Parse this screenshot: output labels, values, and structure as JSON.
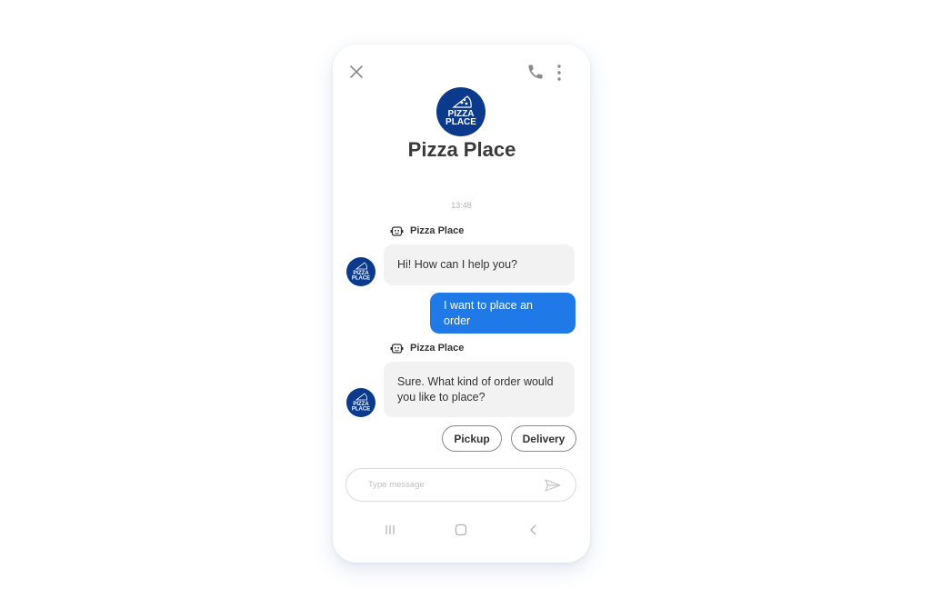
{
  "header": {
    "close_icon": "close-icon",
    "call_icon": "phone-icon",
    "menu_icon": "more-vertical-icon",
    "logo_text_line1": "PIZZA",
    "logo_text_line2": "PLACE",
    "title": "Pizza Place"
  },
  "chat": {
    "timestamp": "13:48",
    "messages": [
      {
        "from": "bot",
        "sender": "Pizza Place",
        "lines": [
          "Hi! How can I help you?"
        ]
      },
      {
        "from": "user",
        "lines": [
          "I want to place an order"
        ]
      },
      {
        "from": "bot",
        "sender": "Pizza Place",
        "lines": [
          "Sure. What kind of order would",
          "you like to place?"
        ]
      }
    ],
    "quick_replies": [
      "Pickup",
      "Delivery"
    ]
  },
  "composer": {
    "placeholder": "Type message",
    "value": "",
    "send_icon": "send-icon"
  },
  "navbar": {
    "recents_icon": "recents-icon",
    "home_icon": "home-icon",
    "back_icon": "back-icon"
  },
  "colors": {
    "brand": "#0b3a8c",
    "user_bubble": "#1f7ae8",
    "bot_bubble": "#f2f2f2"
  }
}
